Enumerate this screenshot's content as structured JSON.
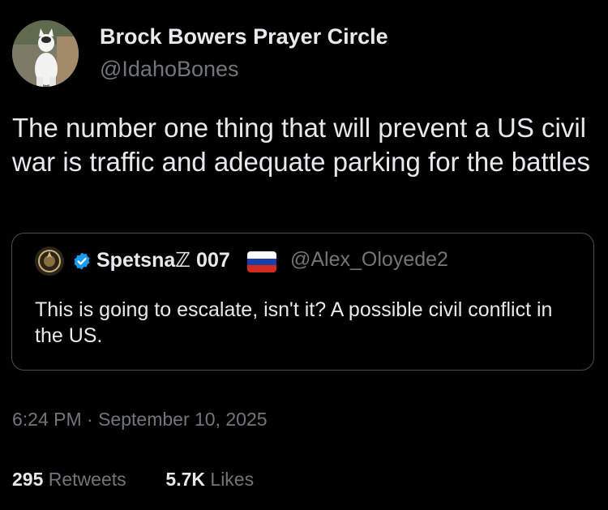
{
  "author": {
    "display_name": "Brock Bowers Prayer Circle",
    "handle": "@IdahoBones",
    "avatar_icon": "cat-photo-avatar"
  },
  "tweet": {
    "text": "The number one thing that will prevent a US civil war is traffic and adequate parking for the battles"
  },
  "quote": {
    "display_name": "Spetsnaℤ 007",
    "handle": "@Alex_Oloyede2",
    "verified_icon": "verified-badge-icon",
    "flag_icon": "russia-flag-icon",
    "text": "This is going to escalate, isn't it? A possible civil conflict in the US.",
    "colors": {
      "verified": "#1d9bf0"
    }
  },
  "meta": {
    "timestamp": "6:24 PM · September 10, 2025",
    "retweets_count": "295",
    "retweets_label": "Retweets",
    "likes_count": "5.7K",
    "likes_label": "Likes"
  },
  "colors": {
    "background": "#000000",
    "text_primary": "#e7e9ea",
    "text_secondary": "#71767b",
    "border": "#4a4e52"
  }
}
